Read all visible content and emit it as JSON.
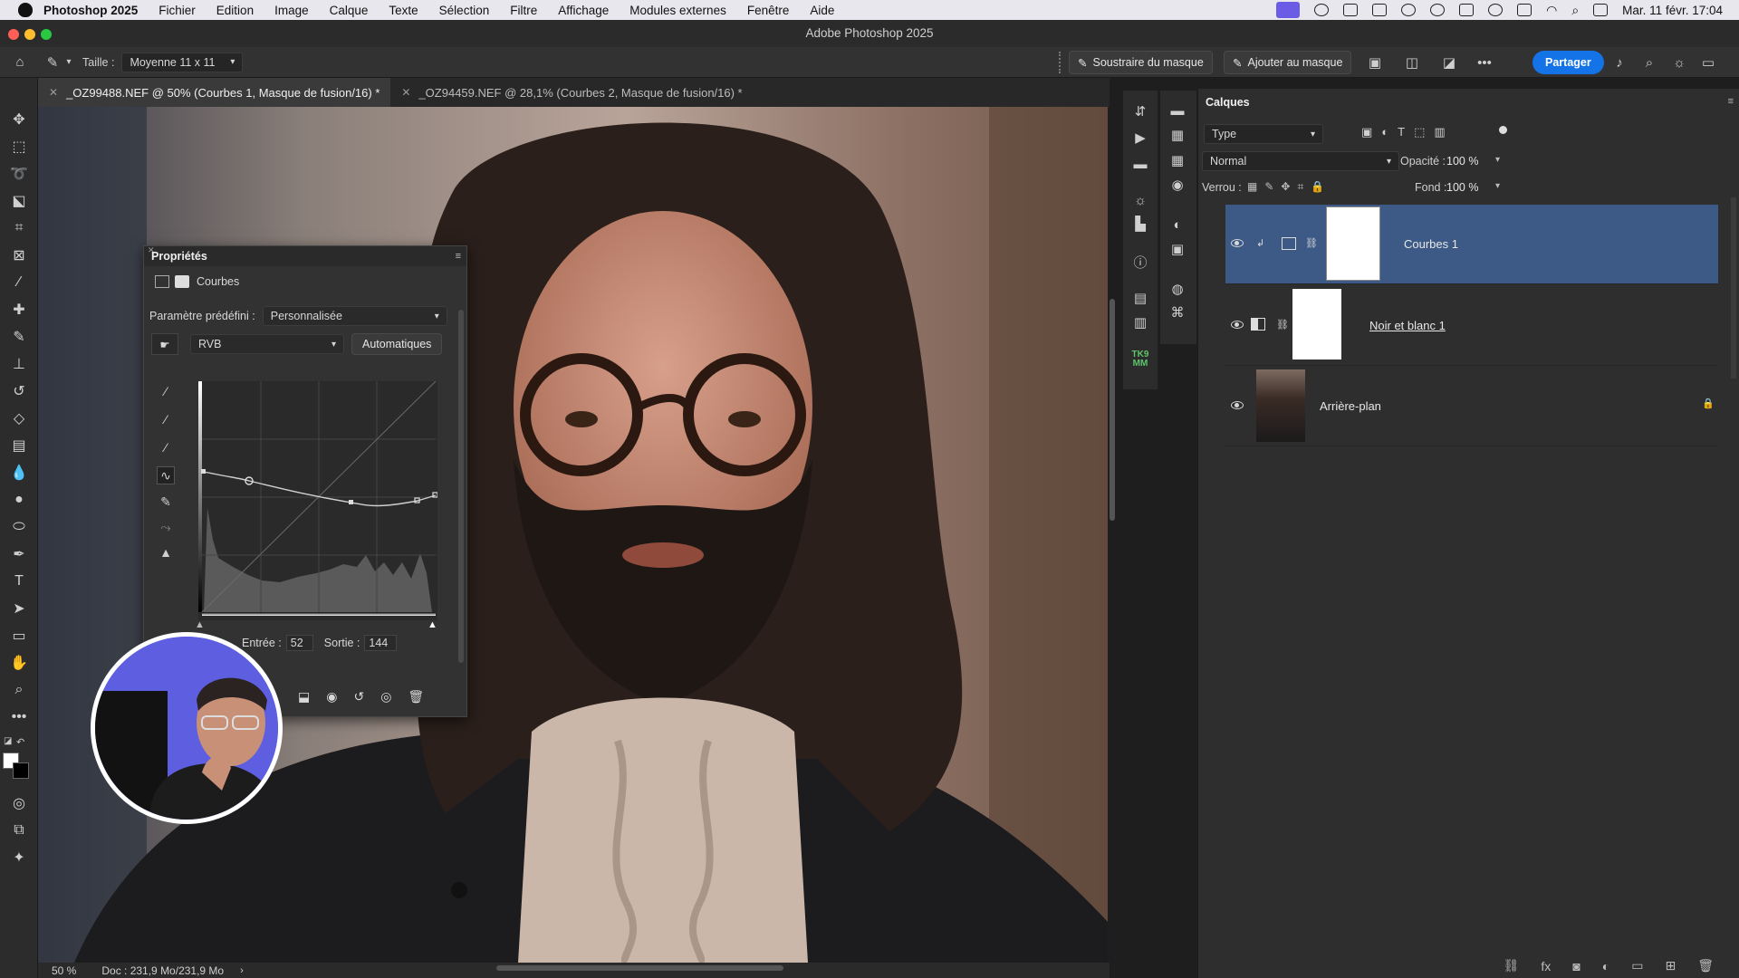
{
  "menubar": {
    "app_name": "Photoshop 2025",
    "items": [
      "Fichier",
      "Edition",
      "Image",
      "Calque",
      "Texte",
      "Sélection",
      "Filtre",
      "Affichage",
      "Modules externes",
      "Fenêtre",
      "Aide"
    ],
    "datetime": "Mar. 11 févr.  17:04"
  },
  "window": {
    "title": "Adobe Photoshop 2025"
  },
  "options_bar": {
    "size_label": "Taille :",
    "size_value": "Moyenne 11 x 11",
    "subtract_mask": "Soustraire du masque",
    "add_mask": "Ajouter au masque",
    "share": "Partager"
  },
  "tabs": [
    {
      "label": "_OZ99488.NEF @ 50% (Courbes 1, Masque de fusion/16) *",
      "active": true
    },
    {
      "label": "_OZ94459.NEF @ 28,1% (Courbes 2, Masque de fusion/16) *",
      "active": false
    }
  ],
  "status": {
    "zoom": "50 %",
    "doc": "Doc : 231,9 Mo/231,9 Mo"
  },
  "properties": {
    "title": "Propriétés",
    "adjustment": "Courbes",
    "preset_label": "Paramètre prédéfini :",
    "preset_value": "Personnalisée",
    "channel": "RVB",
    "auto_button": "Automatiques",
    "input_label": "Entrée :",
    "input_value": "52",
    "output_label": "Sortie :",
    "output_value": "144"
  },
  "layers_panel": {
    "title": "Calques",
    "filter_type": "Type",
    "blend_mode": "Normal",
    "opacity_label": "Opacité :",
    "opacity_value": "100 %",
    "lock_label": "Verrou :",
    "fill_label": "Fond :",
    "fill_value": "100 %",
    "layers": [
      {
        "name": "Courbes 1",
        "selected": true
      },
      {
        "name": "Noir et blanc 1",
        "selected": false
      },
      {
        "name": "Arrière-plan",
        "selected": false
      }
    ]
  },
  "side_strip_label": "TK9 MM",
  "colors": {
    "accent": "#1473e6",
    "layer_selected": "#3d5a86",
    "panel_bg": "#2e2e2e"
  }
}
